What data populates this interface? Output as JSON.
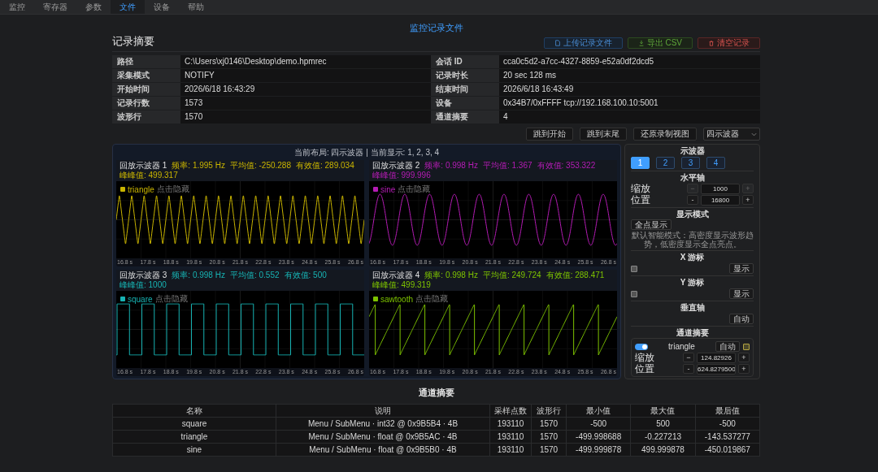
{
  "tabs": [
    {
      "label": "监控",
      "selected": false
    },
    {
      "label": "寄存器",
      "selected": false
    },
    {
      "label": "参数",
      "selected": false
    },
    {
      "label": "文件",
      "selected": true
    },
    {
      "label": "设备",
      "selected": false
    },
    {
      "label": "帮助",
      "selected": false
    }
  ],
  "page_title": "监控记录文件",
  "summary": {
    "title": "记录摘要",
    "buttons": [
      {
        "label": "上传记录文件",
        "kind": "upload"
      },
      {
        "label": "导出 CSV",
        "kind": "export"
      },
      {
        "label": "清空记录",
        "kind": "clear"
      }
    ],
    "rows": [
      [
        {
          "label": "路径",
          "value": "C:\\Users\\xj0146\\Desktop\\demo.hpmrec"
        },
        {
          "label": "会话 ID",
          "value": "cca0c5d2-a7cc-4327-8859-e52a0df2dcd5"
        }
      ],
      [
        {
          "label": "采集模式",
          "value": "NOTIFY"
        },
        {
          "label": "记录时长",
          "value": "20 sec 128 ms"
        }
      ],
      [
        {
          "label": "开始时间",
          "value": "2026/6/18 16:43:29"
        },
        {
          "label": "结束时间",
          "value": "2026/6/18 16:43:49"
        }
      ],
      [
        {
          "label": "记录行数",
          "value": "1573"
        },
        {
          "label": "设备",
          "value": "0x34B7/0xFFFF tcp://192.168.100.10:5001"
        }
      ],
      [
        {
          "label": "波形行",
          "value": "1570"
        },
        {
          "label": "通道摘要",
          "value": "4"
        }
      ]
    ]
  },
  "playback": {
    "buttons": [
      "跳到开始",
      "跳到末尾",
      "还原录制视图"
    ],
    "layout_select": "四示波器",
    "layout_info": "当前布局: 四示波器 | 当前显示: 1, 2, 3, 4",
    "scopes": [
      {
        "title": "回放示波器 1",
        "color": "#c9b400",
        "kind": "triangle",
        "legend": "triangle",
        "legend_hint": "点击隐藏",
        "stats": [
          "频率: 1.995 Hz",
          "平均值: -250.288",
          "有效值: 289.034",
          "峰峰值: 499.317"
        ],
        "ticks": [
          "16.8 s",
          "17.8 s",
          "18.8 s",
          "19.8 s",
          "20.8 s",
          "21.8 s",
          "22.8 s",
          "23.8 s",
          "24.8 s",
          "25.8 s",
          "26.8 s"
        ]
      },
      {
        "title": "回放示波器 2",
        "color": "#b51cb5",
        "kind": "sine",
        "legend": "sine",
        "legend_hint": "点击隐藏",
        "stats": [
          "频率: 0.998 Hz",
          "平均值: 1.367",
          "有效值: 353.322",
          "峰峰值: 999.996"
        ],
        "ticks": [
          "16.8 s",
          "17.8 s",
          "18.8 s",
          "19.8 s",
          "20.8 s",
          "21.8 s",
          "22.8 s",
          "23.8 s",
          "24.8 s",
          "25.8 s",
          "26.8 s"
        ]
      },
      {
        "title": "回放示波器 3",
        "color": "#17b3b3",
        "kind": "square",
        "legend": "square",
        "legend_hint": "点击隐藏",
        "stats": [
          "频率: 0.998 Hz",
          "平均值: 0.552",
          "有效值: 500",
          "峰峰值: 1000"
        ],
        "ticks": [
          "16.8 s",
          "17.8 s",
          "18.8 s",
          "19.8 s",
          "20.8 s",
          "21.8 s",
          "22.8 s",
          "23.8 s",
          "24.8 s",
          "25.8 s",
          "26.8 s"
        ]
      },
      {
        "title": "回放示波器 4",
        "color": "#7dc200",
        "kind": "sawtooth",
        "legend": "sawtooth",
        "legend_hint": "点击隐藏",
        "stats": [
          "频率: 0.998 Hz",
          "平均值: 249.724",
          "有效值: 288.471",
          "峰峰值: 499.319"
        ],
        "ticks": [
          "16.8 s",
          "17.8 s",
          "18.8 s",
          "19.8 s",
          "20.8 s",
          "21.8 s",
          "22.8 s",
          "23.8 s",
          "24.8 s",
          "25.8 s",
          "26.8 s"
        ]
      }
    ]
  },
  "controls": {
    "scope_title": "示波器",
    "scope_buttons": [
      {
        "label": "1",
        "selected": true
      },
      {
        "label": "2",
        "selected": false
      },
      {
        "label": "3",
        "selected": false
      },
      {
        "label": "4",
        "selected": false
      }
    ],
    "horizontal": {
      "title": "水平轴",
      "rows": [
        {
          "label": "缩放",
          "value": "1000",
          "minus": "−",
          "plus": "+",
          "disabled": true
        },
        {
          "label": "位置",
          "value": "16800",
          "minus": "-",
          "plus": "+",
          "disabled": false
        }
      ]
    },
    "display_mode": {
      "title": "显示模式",
      "button": "全点显示",
      "hint": "默认智能模式：高密度显示波形趋势，低密度显示全点亮点。"
    },
    "x_cursor": {
      "title": "X 游标",
      "checked": false,
      "button": "显示"
    },
    "y_cursor": {
      "title": "Y 游标",
      "checked": false,
      "button": "显示"
    },
    "vertical": {
      "title": "垂直轴",
      "button": "自动"
    },
    "channel": {
      "title": "通道摘要",
      "enabled": true,
      "name": "triangle",
      "auto": "自动",
      "checked": false,
      "rows": [
        {
          "label": "缩放",
          "value": "124.82926",
          "minus": "−",
          "plus": "+",
          "disabled": false
        },
        {
          "label": "位置",
          "value": "624.8279500",
          "minus": "-",
          "plus": "+",
          "disabled": false
        }
      ]
    }
  },
  "channels": {
    "title": "通道摘要",
    "columns": [
      "名称",
      "说明",
      "采样点数",
      "波形行",
      "最小值",
      "最大值",
      "最后值"
    ],
    "rows": [
      [
        "square",
        "Menu / SubMenu · int32 @ 0x9B5B4 · 4B",
        "193110",
        "1570",
        "-500",
        "500",
        "-500"
      ],
      [
        "triangle",
        "Menu / SubMenu · float @ 0x9B5AC · 4B",
        "193110",
        "1570",
        "-499.998688",
        "-0.227213",
        "-143.537277"
      ],
      [
        "sine",
        "Menu / SubMenu · float @ 0x9B5B0 · 4B",
        "193110",
        "1570",
        "-499.999878",
        "499.999878",
        "-450.019867"
      ]
    ]
  }
}
